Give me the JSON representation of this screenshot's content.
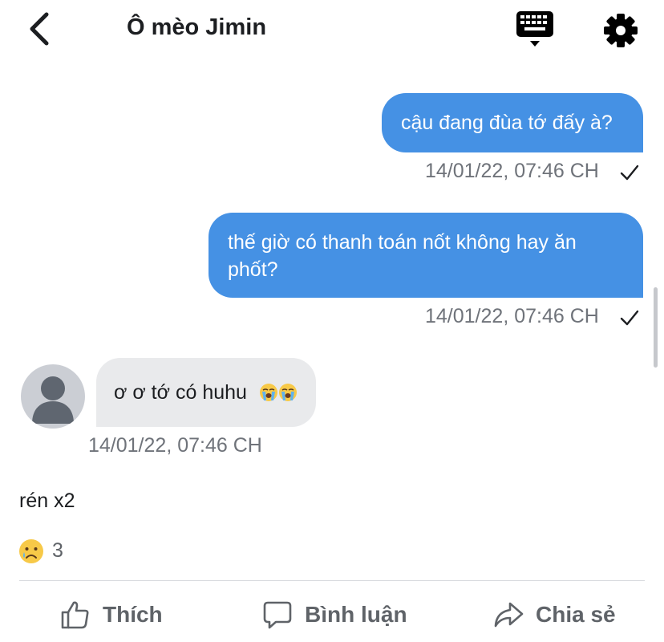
{
  "header": {
    "title": "Ô mèo Jimin",
    "back_icon": "chevron-left-icon",
    "keyboard_icon": "keyboard-icon",
    "settings_icon": "gear-icon"
  },
  "messages": [
    {
      "direction": "outgoing",
      "text": "cậu đang đùa tớ đấy à?",
      "timestamp": "14/01/22, 07:46 CH",
      "status": "sent"
    },
    {
      "direction": "outgoing",
      "text": "thế giờ có thanh toán nốt không hay ăn phốt?",
      "timestamp": "14/01/22, 07:46 CH",
      "status": "sent"
    },
    {
      "direction": "incoming",
      "text": "ơ ơ tớ có huhu",
      "emoji": "loudly-crying-face x2",
      "timestamp": "14/01/22, 07:46 CH"
    }
  ],
  "post": {
    "caption": "rén x2",
    "reaction_icon": "sad-face-icon",
    "reaction_count": "3"
  },
  "actions": {
    "like": "Thích",
    "comment": "Bình luận",
    "share": "Chia sẻ"
  },
  "colors": {
    "outgoing_bubble": "#4591e4",
    "incoming_bubble": "#e9eaec",
    "muted_text": "#6f737a"
  }
}
